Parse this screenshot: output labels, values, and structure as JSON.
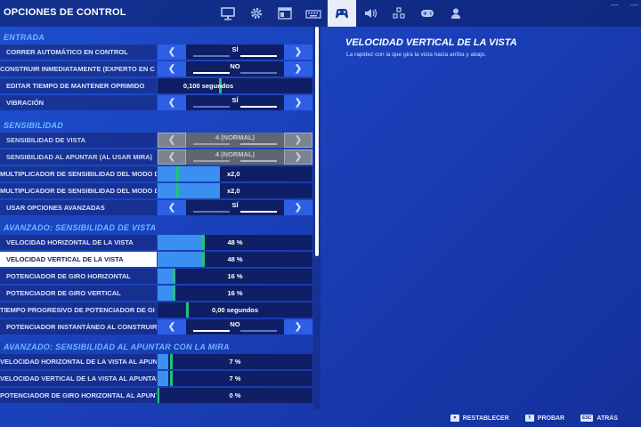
{
  "header": {
    "title": "OPCIONES DE CONTROL",
    "tabs": [
      {
        "icon": "monitor-icon"
      },
      {
        "icon": "gear-icon"
      },
      {
        "icon": "window-icon"
      },
      {
        "icon": "keyboard-icon"
      },
      {
        "icon": "controller-settings-icon",
        "active": true
      },
      {
        "icon": "speaker-icon"
      },
      {
        "icon": "accessibility-icon"
      },
      {
        "icon": "gamepad-icon"
      },
      {
        "icon": "user-icon"
      }
    ]
  },
  "sections": {
    "entrada": "ENTRADA",
    "sensibilidad": "SENSIBILIDAD",
    "avanzado_vista": "AVANZADO: SENSIBILIDAD DE VISTA",
    "avanzado_mira": "AVANZADO: SENSIBILIDAD AL APUNTAR CON LA MIRA"
  },
  "rows": {
    "correr": {
      "label": "CORRER AUTOMÁTICO EN CONTROL",
      "value": "SÍ"
    },
    "construir": {
      "label": "CONSTRUIR INMEDIATAMENTE (EXPERTO EN C",
      "value": "NO"
    },
    "mantener": {
      "label": "EDITAR TIEMPO DE MANTENER OPRIMIDO",
      "value": "0,100 segundos",
      "level": 0.66
    },
    "vibracion": {
      "label": "VIBRACIÓN",
      "value": "SÍ"
    },
    "sens_vista": {
      "label": "SENSIBILIDAD DE VISTA",
      "value": "4 (NORMAL)"
    },
    "sens_apuntar": {
      "label": "SENSIBILIDAD AL APUNTAR (AL USAR MIRA)",
      "value": "4 (NORMAL)"
    },
    "mult1": {
      "label": "MULTIPLICADOR DE SENSIBILIDAD DEL MODO D",
      "value": "x2,0",
      "level": 0.2
    },
    "mult2": {
      "label": "MULTIPLICADOR DE SENSIBILIDAD DEL MODO D",
      "value": "x2,0",
      "level": 0.2
    },
    "avanzadas": {
      "label": "USAR OPCIONES AVANZADAS",
      "value": "SÍ"
    },
    "vel_h": {
      "label": "VELOCIDAD HORIZONTAL DE LA VISTA",
      "value": "48 %",
      "level": 0.48
    },
    "vel_v": {
      "label": "VELOCIDAD VERTICAL DE LA VISTA",
      "value": "48 %",
      "level": 0.48
    },
    "giro_h": {
      "label": "POTENCIADOR DE GIRO HORIZONTAL",
      "value": "16 %",
      "level": 0.16
    },
    "giro_v": {
      "label": "POTENCIADOR DE GIRO VERTICAL",
      "value": "16 %",
      "level": 0.16
    },
    "tiempo_prog": {
      "label": "TIEMPO PROGRESIVO DE POTENCIADOR DE GI",
      "value": "0,00 segundos",
      "level": 0.0
    },
    "instantaneo": {
      "label": "POTENCIADOR INSTANTÁNEO AL CONSTRUIR",
      "value": "NO"
    },
    "mira_h": {
      "label": "VELOCIDAD HORIZONTAL DE LA VISTA AL APUNTAR",
      "value": "7 %",
      "level": 0.07
    },
    "mira_v": {
      "label": "VELOCIDAD VERTICAL DE LA VISTA AL APUNTAR",
      "value": "7 %",
      "level": 0.07
    },
    "mira_giro": {
      "label": "POTENCIADOR DE GIRO HORIZONTAL AL APUNT",
      "value": "0 %",
      "level": 0.0
    }
  },
  "detail": {
    "title": "VELOCIDAD VERTICAL DE LA VISTA",
    "description": "La rapidez con la que gira la vista hacia arriba y abajo."
  },
  "footer": {
    "reset": {
      "key": "▼",
      "label": "RESTABLECER"
    },
    "test": {
      "key": "Y",
      "label": "PROBAR"
    },
    "back": {
      "key": "ESC",
      "label": "ATRÁS"
    }
  },
  "colors": {
    "accent": "#2c5fe6",
    "slider_fill": "#3a8ff0",
    "knob": "#22c27a",
    "section": "#6fb8ff"
  }
}
